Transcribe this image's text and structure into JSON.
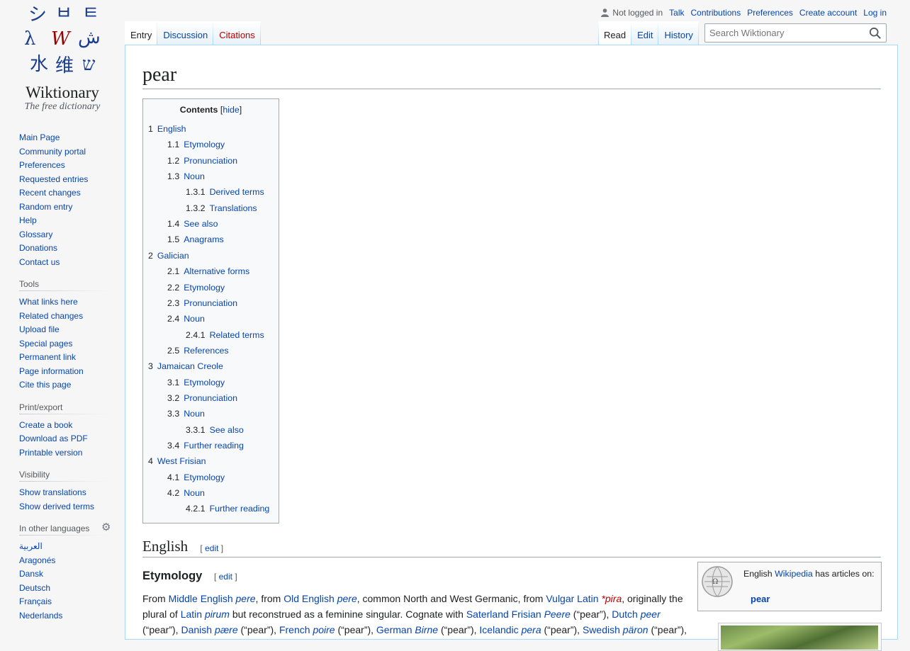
{
  "logo": {
    "wordmark": "Wiktionary",
    "tagline": "The free dictionary",
    "glyphs": [
      "シ",
      "ㅂ",
      "ㅌ",
      "λ",
      "W",
      "ش",
      "水",
      "维",
      "ש"
    ]
  },
  "sidebar": {
    "navigation": [
      "Main Page",
      "Community portal",
      "Preferences",
      "Requested entries",
      "Recent changes",
      "Random entry",
      "Help",
      "Glossary",
      "Donations",
      "Contact us"
    ],
    "tools_title": "Tools",
    "tools": [
      "What links here",
      "Related changes",
      "Upload file",
      "Special pages",
      "Permanent link",
      "Page information",
      "Cite this page"
    ],
    "print_title": "Print/export",
    "print": [
      "Create a book",
      "Download as PDF",
      "Printable version"
    ],
    "visibility_title": "Visibility",
    "visibility": [
      "Show translations",
      "Show derived terms"
    ],
    "languages_title": "In other languages",
    "languages": [
      "العربية",
      "Aragonés",
      "Dansk",
      "Deutsch",
      "Français",
      "Nederlands"
    ]
  },
  "personal": {
    "not_logged_in": "Not logged in",
    "talk": "Talk",
    "contributions": "Contributions",
    "preferences": "Preferences",
    "create_account": "Create account",
    "log_in": "Log in"
  },
  "tabs": {
    "entry": "Entry",
    "discussion": "Discussion",
    "citations": "Citations",
    "read": "Read",
    "edit": "Edit",
    "history": "History"
  },
  "search": {
    "placeholder": "Search Wiktionary"
  },
  "page": {
    "title": "pear",
    "toc_title": "Contents",
    "toc_hide": "hide",
    "toc": [
      {
        "n": "1",
        "t": "English",
        "lvl": 1
      },
      {
        "n": "1.1",
        "t": "Etymology",
        "lvl": 2
      },
      {
        "n": "1.2",
        "t": "Pronunciation",
        "lvl": 2
      },
      {
        "n": "1.3",
        "t": "Noun",
        "lvl": 2
      },
      {
        "n": "1.3.1",
        "t": "Derived terms",
        "lvl": 3
      },
      {
        "n": "1.3.2",
        "t": "Translations",
        "lvl": 3
      },
      {
        "n": "1.4",
        "t": "See also",
        "lvl": 2
      },
      {
        "n": "1.5",
        "t": "Anagrams",
        "lvl": 2
      },
      {
        "n": "2",
        "t": "Galician",
        "lvl": 1
      },
      {
        "n": "2.1",
        "t": "Alternative forms",
        "lvl": 2
      },
      {
        "n": "2.2",
        "t": "Etymology",
        "lvl": 2
      },
      {
        "n": "2.3",
        "t": "Pronunciation",
        "lvl": 2
      },
      {
        "n": "2.4",
        "t": "Noun",
        "lvl": 2
      },
      {
        "n": "2.4.1",
        "t": "Related terms",
        "lvl": 3
      },
      {
        "n": "2.5",
        "t": "References",
        "lvl": 2
      },
      {
        "n": "3",
        "t": "Jamaican Creole",
        "lvl": 1
      },
      {
        "n": "3.1",
        "t": "Etymology",
        "lvl": 2
      },
      {
        "n": "3.2",
        "t": "Pronunciation",
        "lvl": 2
      },
      {
        "n": "3.3",
        "t": "Noun",
        "lvl": 2
      },
      {
        "n": "3.3.1",
        "t": "See also",
        "lvl": 3
      },
      {
        "n": "3.4",
        "t": "Further reading",
        "lvl": 2
      },
      {
        "n": "4",
        "t": "West Frisian",
        "lvl": 1
      },
      {
        "n": "4.1",
        "t": "Etymology",
        "lvl": 2
      },
      {
        "n": "4.2",
        "t": "Noun",
        "lvl": 2
      },
      {
        "n": "4.2.1",
        "t": "Further reading",
        "lvl": 3
      }
    ],
    "section_english": "English",
    "section_etymology": "Etymology",
    "edit_label": "edit",
    "wikipedia_box": {
      "prefix": "English",
      "wikipedia": "Wikipedia",
      "suffix": "has articles on:",
      "link": "pear"
    },
    "etymology_line1": [
      {
        "t": "From ",
        "k": "text"
      },
      {
        "t": "Middle English",
        "k": "link"
      },
      {
        "t": " ",
        "k": "text"
      },
      {
        "t": "pere",
        "k": "ital"
      },
      {
        "t": ", from ",
        "k": "text"
      },
      {
        "t": "Old English",
        "k": "link"
      },
      {
        "t": " ",
        "k": "text"
      },
      {
        "t": "pere",
        "k": "ital"
      },
      {
        "t": ", common North and West Germanic, from ",
        "k": "text"
      },
      {
        "t": "Vulgar Latin",
        "k": "link"
      },
      {
        "t": " ",
        "k": "text"
      },
      {
        "t": "*pira",
        "k": "red"
      },
      {
        "t": ", originally the",
        "k": "text"
      }
    ],
    "etymology_line2": [
      {
        "t": "plural of ",
        "k": "text"
      },
      {
        "t": "Latin",
        "k": "link"
      },
      {
        "t": " ",
        "k": "text"
      },
      {
        "t": "pirum",
        "k": "ital"
      },
      {
        "t": " but reconstrued as a feminine singular. Cognate with ",
        "k": "text"
      },
      {
        "t": "Saterland Frisian",
        "k": "link"
      },
      {
        "t": " ",
        "k": "text"
      },
      {
        "t": "Peere",
        "k": "ital"
      },
      {
        "t": " (“pear”), ",
        "k": "text"
      },
      {
        "t": "Dutch",
        "k": "link"
      },
      {
        "t": " ",
        "k": "text"
      },
      {
        "t": "peer",
        "k": "ital"
      }
    ],
    "etymology_line3": [
      {
        "t": "(“pear”), ",
        "k": "text"
      },
      {
        "t": "Danish",
        "k": "link"
      },
      {
        "t": " ",
        "k": "text"
      },
      {
        "t": "pære",
        "k": "ital"
      },
      {
        "t": " (“pear”), ",
        "k": "text"
      },
      {
        "t": "French",
        "k": "link"
      },
      {
        "t": " ",
        "k": "text"
      },
      {
        "t": "poire",
        "k": "ital"
      },
      {
        "t": " (“pear”), ",
        "k": "text"
      },
      {
        "t": "German",
        "k": "link"
      },
      {
        "t": " ",
        "k": "text"
      },
      {
        "t": "Birne",
        "k": "ital"
      },
      {
        "t": " (“pear”), ",
        "k": "text"
      },
      {
        "t": "Icelandic",
        "k": "link"
      },
      {
        "t": " ",
        "k": "text"
      },
      {
        "t": "pera",
        "k": "ital"
      },
      {
        "t": " (“pear”), ",
        "k": "text"
      },
      {
        "t": "Swedish",
        "k": "link"
      },
      {
        "t": " ",
        "k": "text"
      },
      {
        "t": "päron",
        "k": "ital"
      },
      {
        "t": " (“pear”),",
        "k": "text"
      }
    ]
  },
  "colors": {
    "link": "#0645ad",
    "new_link": "#ba0000",
    "border": "#a7d7f9",
    "text": "#202122"
  }
}
